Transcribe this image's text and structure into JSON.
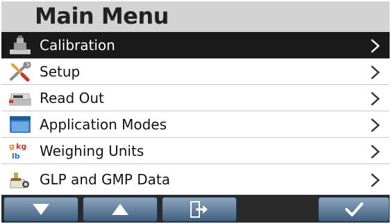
{
  "title": "Main Menu",
  "menu": {
    "items": [
      {
        "label": "Calibration",
        "icon": "calibration-weight-icon"
      },
      {
        "label": "Setup",
        "icon": "wrench-screwdriver-icon"
      },
      {
        "label": "Read Out",
        "icon": "scale-display-icon"
      },
      {
        "label": "Application Modes",
        "icon": "window-icon"
      },
      {
        "label": "Weighing Units",
        "icon": "g-kg-lb-units-icon"
      },
      {
        "label": "GLP and GMP Data",
        "icon": "document-stamp-icon"
      }
    ],
    "selected_index": 0
  },
  "footer": {
    "buttons": [
      {
        "icon": "arrow-down-icon"
      },
      {
        "icon": "arrow-up-icon"
      },
      {
        "icon": "exit-icon"
      },
      {
        "icon": "checkmark-icon"
      }
    ]
  },
  "colors": {
    "title_bar": "#d3d3d3",
    "selected_row": "#1a1a1a",
    "button_gradient_top": "#8ea6bf",
    "button_gradient_bottom": "#3f5f80",
    "button_bar": "#2a2a2a"
  }
}
